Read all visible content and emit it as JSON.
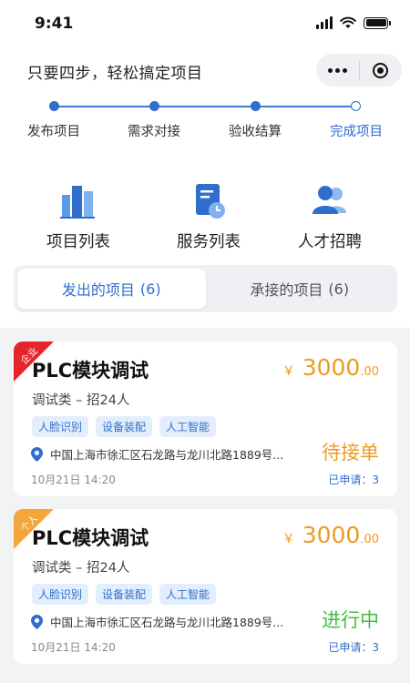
{
  "status_bar": {
    "time": "9:41"
  },
  "header": {
    "title": "只要四步，轻松搞定项目"
  },
  "capsule": {
    "more_icon": "more-dots-icon",
    "close_icon": "target-circle-icon"
  },
  "steps": [
    {
      "label": "发布项目"
    },
    {
      "label": "需求对接"
    },
    {
      "label": "验收结算"
    },
    {
      "label": "完成项目"
    }
  ],
  "nav": [
    {
      "label": "项目列表",
      "icon": "chart-bars-icon"
    },
    {
      "label": "服务列表",
      "icon": "document-clock-icon"
    },
    {
      "label": "人才招聘",
      "icon": "people-icon"
    }
  ],
  "tabs": [
    {
      "label": "发出的项目",
      "count": "(6)",
      "active": true
    },
    {
      "label": "承接的项目",
      "count": "(6)",
      "active": false
    }
  ],
  "cards": [
    {
      "badge": "企业",
      "badge_color": "#e8242b",
      "title": "PLC模块调试",
      "currency": "￥",
      "price_int": "3000",
      "price_dec": ".00",
      "subtitle": "调试类 – 招24人",
      "tags": [
        "人脸识别",
        "设备装配",
        "人工智能"
      ],
      "address": "中国上海市徐汇区石龙路与龙川北路1889号...",
      "status": "待接单",
      "status_color": "#ec9b22",
      "date": "10月21日 14:20",
      "applied": "已申请：3"
    },
    {
      "badge": "个人",
      "badge_color": "#f4a63a",
      "title": "PLC模块调试",
      "currency": "￥",
      "price_int": "3000",
      "price_dec": ".00",
      "subtitle": "调试类 – 招24人",
      "tags": [
        "人脸识别",
        "设备装配",
        "人工智能"
      ],
      "address": "中国上海市徐汇区石龙路与龙川北路1889号...",
      "status": "进行中",
      "status_color": "#3fbe3f",
      "date": "10月21日 14:20",
      "applied": "已申请：3"
    }
  ],
  "colors": {
    "accent": "#2f6fcb",
    "price": "#ec9b22",
    "list_bg": "#f2f3f5"
  }
}
